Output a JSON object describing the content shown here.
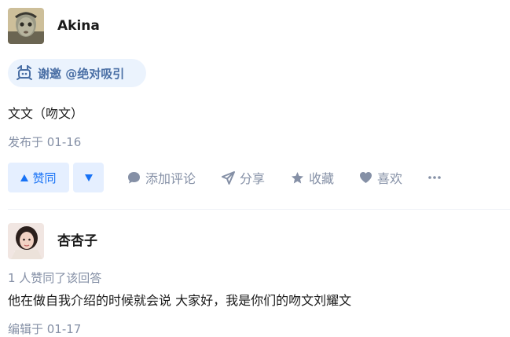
{
  "answer1": {
    "author": "Akina",
    "invite_text": "谢邀 @绝对吸引",
    "content": "文文（吻文）",
    "publish_time": "发布于 01-16",
    "actions": {
      "upvote": "赞同",
      "comment": "添加评论",
      "share": "分享",
      "favorite": "收藏",
      "like": "喜欢"
    }
  },
  "answer2": {
    "author": "杏杏子",
    "upvote_count": "1 人赞同了该回答",
    "content": "他在做自我介绍的时候就会说 大家好，我是你们的吻文刘耀文",
    "edit_time": "编辑于 01-17"
  },
  "colors": {
    "accent": "#1772f6",
    "meta_gray": "#8590a6",
    "invite_bg": "#ebf3fd"
  }
}
